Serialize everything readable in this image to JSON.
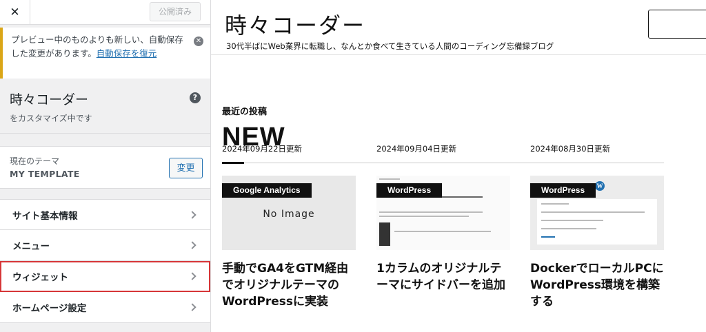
{
  "sidebar": {
    "close_label": "✕",
    "publish_label": "公開済み",
    "notice": {
      "text": "プレビュー中のものよりも新しい、自動保存した変更があります。",
      "link": "自動保存を復元"
    },
    "site_title": "時々コーダー",
    "site_subtitle": "をカスタマイズ中です",
    "help_icon": "?",
    "theme": {
      "label": "現在のテーマ",
      "name": "MY TEMPLATE",
      "change_label": "変更"
    },
    "items": [
      {
        "label": "サイト基本情報"
      },
      {
        "label": "メニュー"
      },
      {
        "label": "ウィジェット"
      },
      {
        "label": "ホームページ設定"
      }
    ]
  },
  "preview": {
    "site_name": "時々コーダー",
    "tagline": "30代半ばにWeb業界に転職し、なんとか食べて生きている人間のコーディング忘備録ブログ",
    "section_label": "最近の投稿",
    "section_title": "NEW",
    "posts": [
      {
        "category": "Google Analytics",
        "thumb": "No Image",
        "title": "手動でGA4をGTM経由でオリジナルテーマのWordPressに実装",
        "date": "2024年09月22日更新"
      },
      {
        "category": "WordPress",
        "title": "1カラムのオリジナルテーマにサイドバーを追加",
        "date": "2024年09月04日更新"
      },
      {
        "category": "WordPress",
        "title": "DockerでローカルPCにWordPress環境を構築する",
        "date": "2024年08月30日更新"
      }
    ]
  },
  "colors": {
    "notice_border": "#dba617",
    "link": "#2271b1",
    "highlight": "#d63638",
    "category_bg": "#111111"
  }
}
